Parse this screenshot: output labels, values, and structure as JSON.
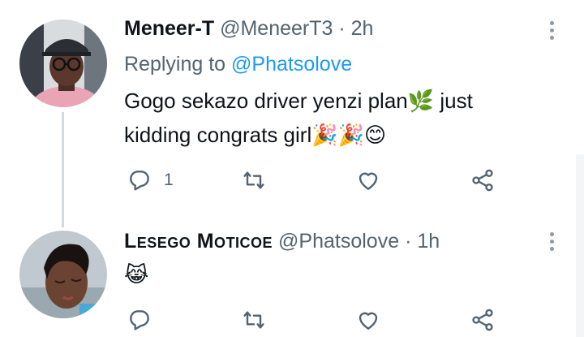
{
  "tweets": [
    {
      "author_name": "Meneer-T",
      "handle": "@MeneerT3",
      "separator": "·",
      "time": "2h",
      "replying_label": "Replying to",
      "replying_to": "@Phatsolove",
      "text_line1": "Gogo sekazo driver yenzi plan🌿 just",
      "text_line2": "kidding congrats girl🎉🎉😊",
      "reply_count": "1"
    },
    {
      "author_name": "Lesego Moticoe",
      "handle": "@Phatsolove",
      "separator": "·",
      "time": "1h",
      "text": "😹",
      "reply_count": ""
    }
  ],
  "icons": {
    "reply": "reply-icon",
    "retweet": "retweet-icon",
    "like": "heart-icon",
    "share": "share-icon",
    "more": "more-options-icon"
  },
  "colors": {
    "text": "#0f1419",
    "muted": "#536471",
    "mention": "#1d9bf0",
    "thread_line": "#cfd9de"
  }
}
